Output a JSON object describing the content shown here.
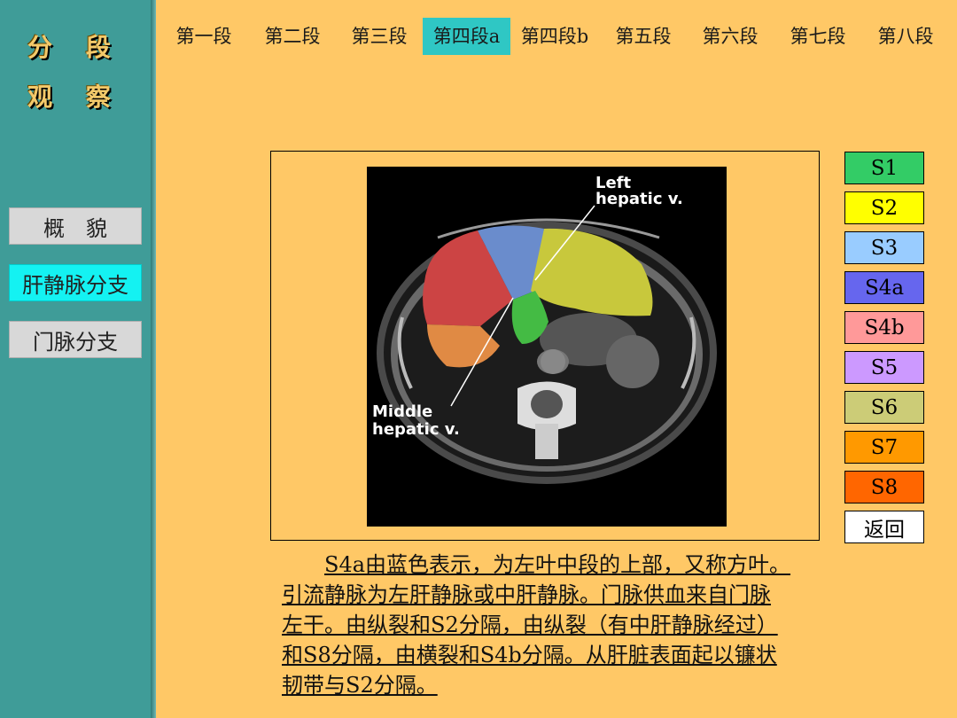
{
  "sidebar": {
    "title_line1": "分 段",
    "title_line2": "观 察",
    "items": [
      {
        "label": "概　貌",
        "active": false
      },
      {
        "label": "肝静脉分支",
        "active": true
      },
      {
        "label": "门脉分支",
        "active": false
      }
    ]
  },
  "tabs": [
    {
      "label": "第一段",
      "active": false
    },
    {
      "label": "第二段",
      "active": false
    },
    {
      "label": "第三段",
      "active": false
    },
    {
      "label": "第四段a",
      "active": true
    },
    {
      "label": "第四段b",
      "active": false
    },
    {
      "label": "第五段",
      "active": false
    },
    {
      "label": "第六段",
      "active": false
    },
    {
      "label": "第七段",
      "active": false
    },
    {
      "label": "第八段",
      "active": false
    }
  ],
  "segments": [
    {
      "label": "S1",
      "color": "#33cc66"
    },
    {
      "label": "S2",
      "color": "#ffff00"
    },
    {
      "label": "S3",
      "color": "#99ccff"
    },
    {
      "label": "S4a",
      "color": "#6666ee"
    },
    {
      "label": "S4b",
      "color": "#ff9999"
    },
    {
      "label": "S5",
      "color": "#cc99ff"
    },
    {
      "label": "S6",
      "color": "#cccc77"
    },
    {
      "label": "S7",
      "color": "#ff9900"
    },
    {
      "label": "S8",
      "color": "#ff6600"
    },
    {
      "label": "返回",
      "color": "#ffffff"
    }
  ],
  "image": {
    "label_left_hepatic_line1": "Left",
    "label_left_hepatic_line2": "hepatic v.",
    "label_middle_hepatic_line1": "Middle",
    "label_middle_hepatic_line2": "hepatic v."
  },
  "description": {
    "line1": "S4a由蓝色表示，为左叶中段的上部，又称方叶。",
    "line2": "引流静脉为左肝静脉或中肝静脉。门脉供血来自门脉",
    "line3": "左干。由纵裂和S2分隔，由纵裂（有中肝静脉经过）",
    "line4": "和S8分隔，由横裂和S4b分隔。从肝脏表面起以镰状",
    "line5": "韧带与S2分隔。"
  }
}
